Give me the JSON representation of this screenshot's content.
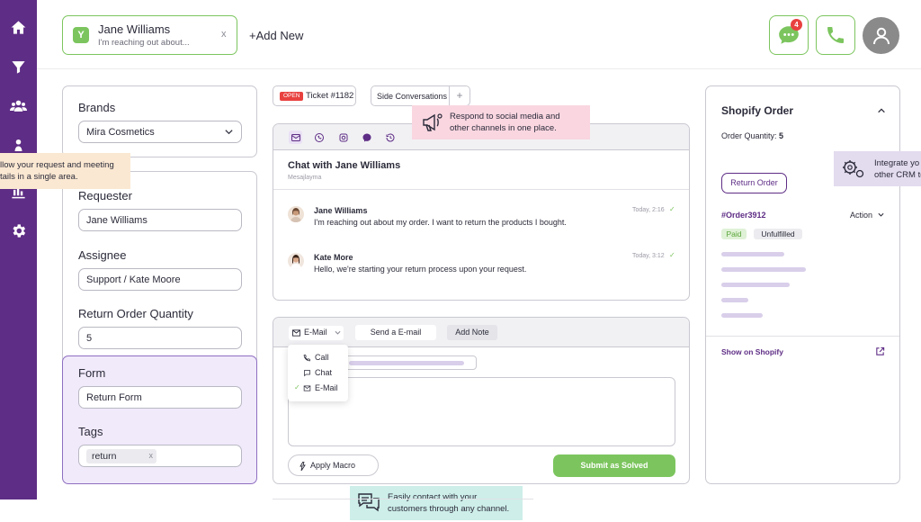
{
  "sidebar": {
    "items": [
      {
        "icon": "home-icon"
      },
      {
        "icon": "filter-icon"
      },
      {
        "icon": "users-icon"
      },
      {
        "icon": "org-chart-icon"
      },
      {
        "icon": "reports-icon"
      },
      {
        "icon": "gear-icon"
      }
    ]
  },
  "topbar": {
    "conversation": {
      "avatar_letter": "Y",
      "name": "Jane Williams",
      "preview": "I'm reaching out about...",
      "close": "x"
    },
    "add_new": "+Add New",
    "chat_badge_count": "4"
  },
  "left": {
    "brands": {
      "label": "Brands",
      "value": "Mira Cosmetics"
    },
    "requester": {
      "label": "Requester",
      "value": "Jane Williams"
    },
    "assignee": {
      "label": "Assignee",
      "value": "Support / Kate Moore"
    },
    "return_qty": {
      "label": "Return Order Quantity",
      "value": "5"
    },
    "form": {
      "label": "Form",
      "value": "Return Form"
    },
    "tags": {
      "label": "Tags",
      "chip": "return",
      "chip_remove": "x"
    }
  },
  "callouts": {
    "orange": {
      "line1": "llow your request and meeting",
      "line2": "tails in a single area."
    },
    "pink": {
      "line1": "Respond to social media and",
      "line2": "other channels in one place."
    },
    "lavender": {
      "line1": "Integrate yo",
      "line2": "other CRM to"
    },
    "teal": {
      "line1": "Easily contact with your",
      "line2": "customers through any channel."
    }
  },
  "ticket": {
    "status": "OPEN",
    "number": "Ticket #1182",
    "side_conversations": "Side Conversations",
    "side_plus": "+"
  },
  "chat": {
    "channels": [
      "email-icon",
      "whatsapp-icon",
      "instagram-icon",
      "messenger-icon",
      "history-icon"
    ],
    "title": "Chat with Jane Williams",
    "subtitle": "Mesajlayma",
    "messages": [
      {
        "name": "Jane Williams",
        "text": "I'm reaching out about my order. I want to return the products I bought.",
        "time": "Today, 2:16",
        "check": "✓"
      },
      {
        "name": "Kate More",
        "text": "Hello, we're starting your return process upon your request.",
        "time": "Today, 3:12",
        "check": "✓"
      }
    ]
  },
  "reply": {
    "channel_select": "E-Mail",
    "send_email": "Send a E-mail",
    "add_note": "Add Note",
    "dropdown": [
      {
        "label": "Call",
        "checked": false
      },
      {
        "label": "Chat",
        "checked": false
      },
      {
        "label": "E-Mail",
        "checked": true
      }
    ],
    "check": "✓",
    "apply_macro": "Apply Macro",
    "submit": "Submit as Solved"
  },
  "shopify": {
    "title": "Shopify Order",
    "qty_label": "Order Quantity: ",
    "qty_value": "5",
    "return_order": "Return Order",
    "order_id": "#Order3912",
    "action": "Action",
    "paid": "Paid",
    "unfulfilled": "Unfulfilled",
    "show_link": "Show on Shopify"
  },
  "colors": {
    "sidebar": "#5e2d85",
    "accent_green": "#7cc55e",
    "accent_purple": "#5e2d85",
    "open_red": "#e8413f"
  }
}
